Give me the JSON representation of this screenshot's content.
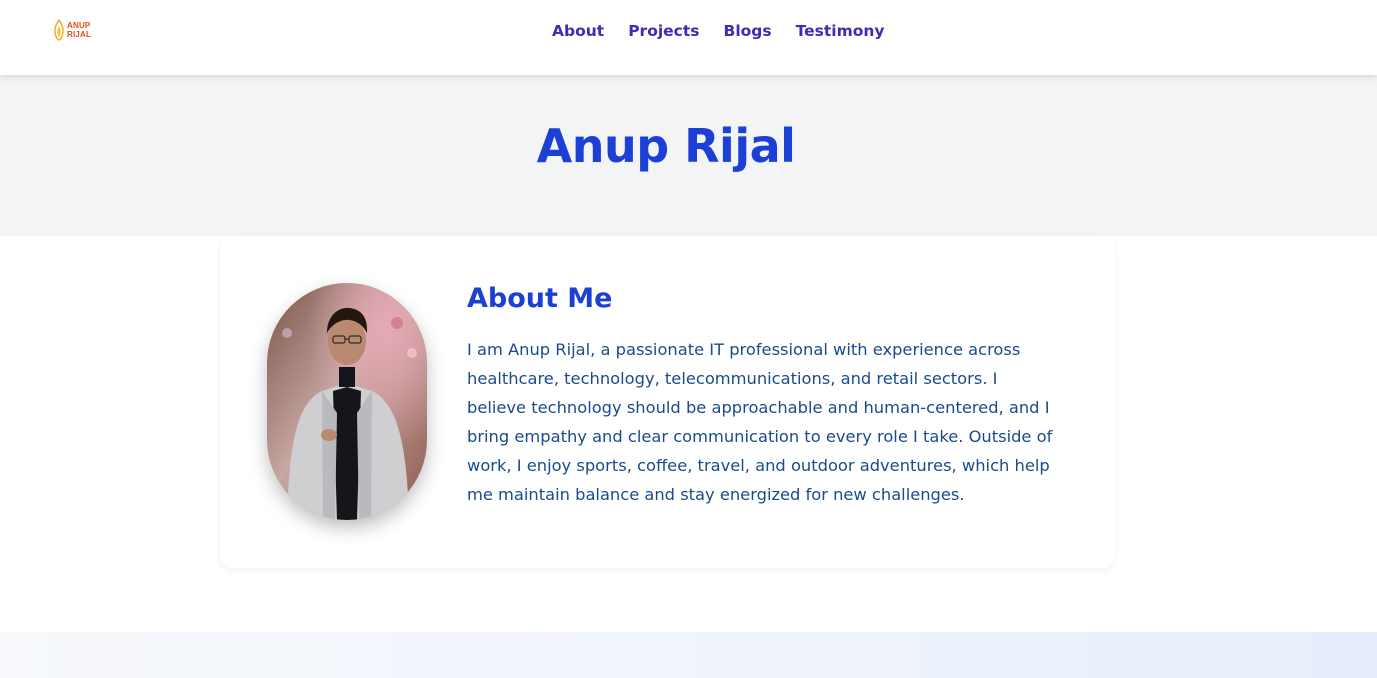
{
  "brand": {
    "logo_line1": "ANUP",
    "logo_line2": "RIJAL",
    "accent_color": "#e24a1d"
  },
  "nav": {
    "items": [
      {
        "label": "About"
      },
      {
        "label": "Projects"
      },
      {
        "label": "Blogs"
      },
      {
        "label": "Testimony"
      }
    ],
    "link_color": "#3a2db8"
  },
  "hero": {
    "title": "Anup Rijal",
    "title_color": "#1c3fd6",
    "background": "#f3f4f6"
  },
  "about": {
    "heading": "About Me",
    "body": "I am Anup Rijal, a passionate IT professional with experience across healthcare, technology, telecommunications, and retail sectors. I believe technology should be approachable and human-centered, and I bring empathy and clear communication to every role I take. Outside of work, I enjoy sports, coffee, travel, and outdoor adventures, which help me maintain balance and stay energized for new challenges.",
    "text_color": "#1a4b8c",
    "photo_icon": "profile-photo"
  }
}
